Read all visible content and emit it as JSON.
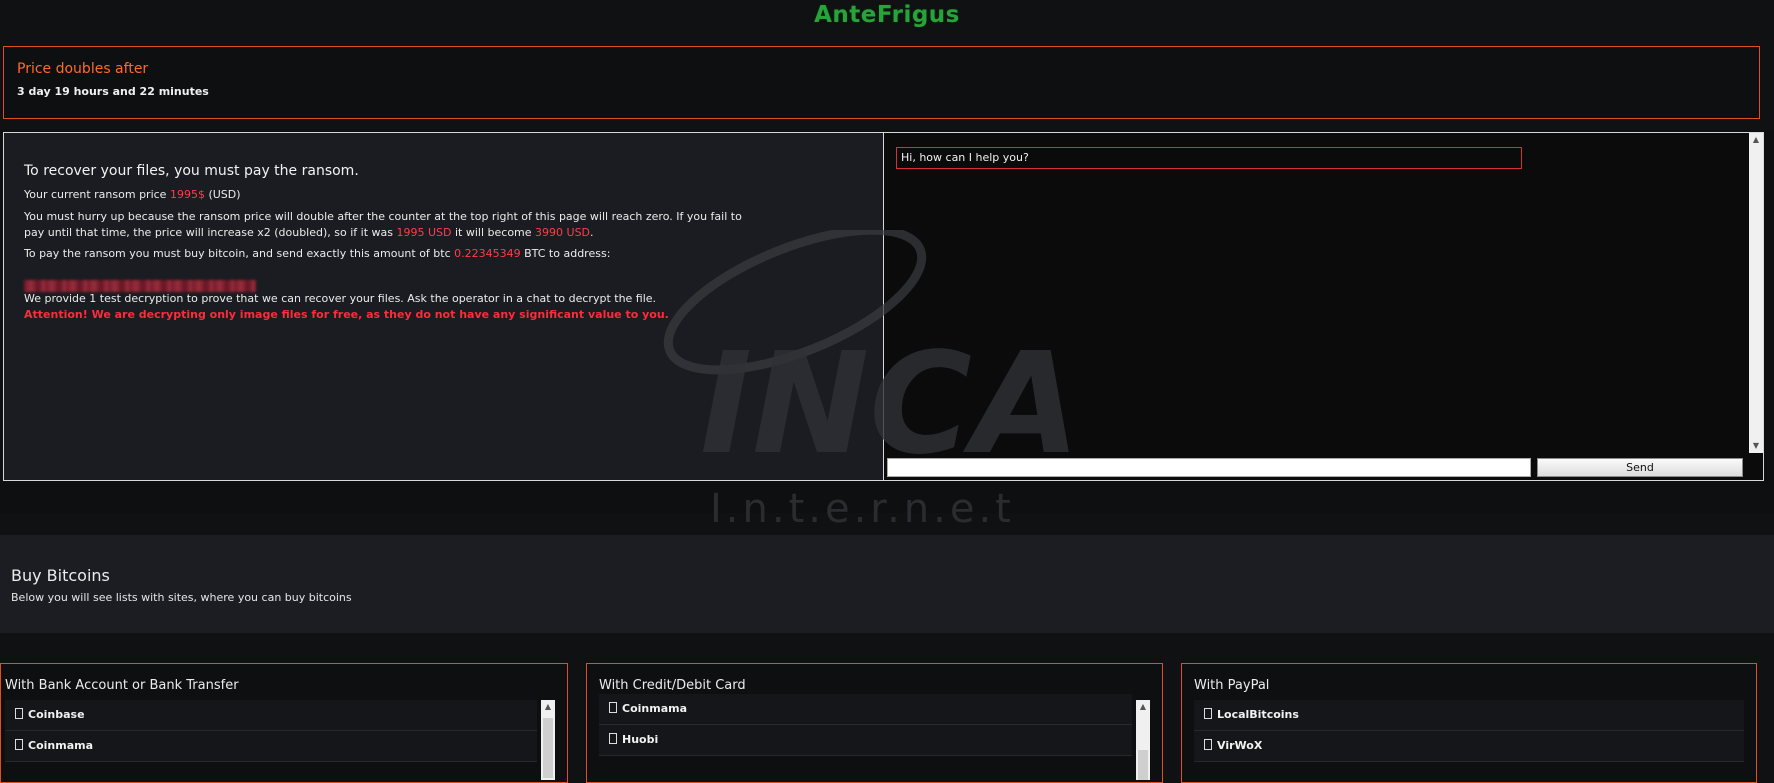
{
  "app": {
    "logo": "AnteFrigus"
  },
  "timer": {
    "title": "Price doubles after",
    "value": "3 day 19 hours and 22 minutes"
  },
  "ransom": {
    "heading": "To recover your files, you must pay the ransom.",
    "price_prefix": "Your current ransom price ",
    "price": "1995$",
    "price_suffix": " (USD)",
    "hurry_1": "You must hurry up because the ransom price will double after the counter at the top right of this page will reach zero. If you fail to pay until that time, the price will increase x2 (doubled), so if it was ",
    "old_price": "1995 USD",
    "hurry_2": " it will become ",
    "new_price": "3990 USD",
    "hurry_3": ".",
    "btc_prefix": "To pay the ransom you must buy bitcoin, and send exactly this amount of btc ",
    "btc_amount": "0.22345349",
    "btc_suffix": " BTC to address:",
    "test_decrypt": "We provide 1 test decryption to prove that we can recover your files. Ask the operator in a chat to decrypt the file.",
    "attention": "Attention! We are decrypting only image files for free, as they do not have any significant value to you."
  },
  "chat": {
    "message": "Hi, how can I help you?",
    "input_value": "",
    "send_label": "Send"
  },
  "watermark": {
    "brand": "INCA",
    "sub": "I.n.t.e.r.n.e.t"
  },
  "buy": {
    "title": "Buy Bitcoins",
    "subtitle": "Below you will see lists with sites, where you can buy bitcoins"
  },
  "shops": [
    {
      "title": "With Bank Account or Bank Transfer",
      "items": [
        "Coinbase",
        "Coinmama"
      ]
    },
    {
      "title": "With Credit/Debit Card",
      "items": [
        "Coinmama",
        "Huobi"
      ]
    },
    {
      "title": "With PayPal",
      "items": [
        "LocalBitcoins",
        "VirWoX"
      ]
    }
  ],
  "colors": {
    "accent_orange": "#e0501e",
    "alert_red": "#ff3d4a",
    "logo_green": "#27a33a"
  }
}
